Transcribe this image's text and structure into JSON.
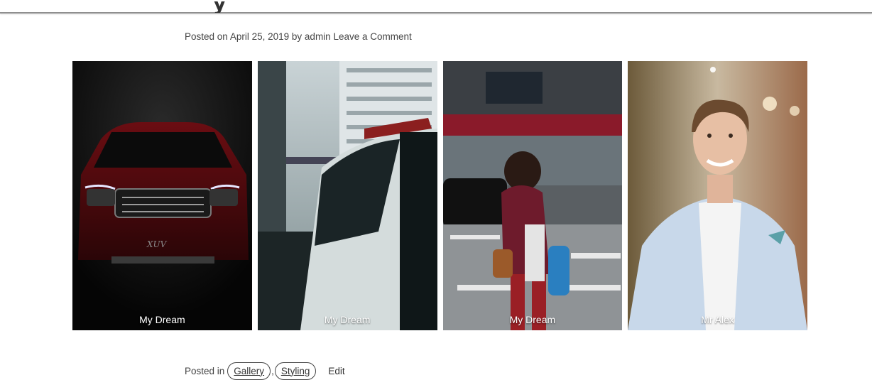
{
  "post": {
    "title_fragment": "y",
    "meta": {
      "posted_on": "Posted on",
      "date": "April 25, 2019",
      "by": "by",
      "author": "admin",
      "comment_link": "Leave a Comment"
    }
  },
  "gallery": [
    {
      "caption": "My Dream"
    },
    {
      "caption": "My Dream"
    },
    {
      "caption": "My Dream"
    },
    {
      "caption": "Mr Alex"
    }
  ],
  "footer": {
    "posted_in": "Posted in",
    "tags": [
      "Gallery",
      "Styling"
    ],
    "separator": ",",
    "edit": "Edit"
  }
}
